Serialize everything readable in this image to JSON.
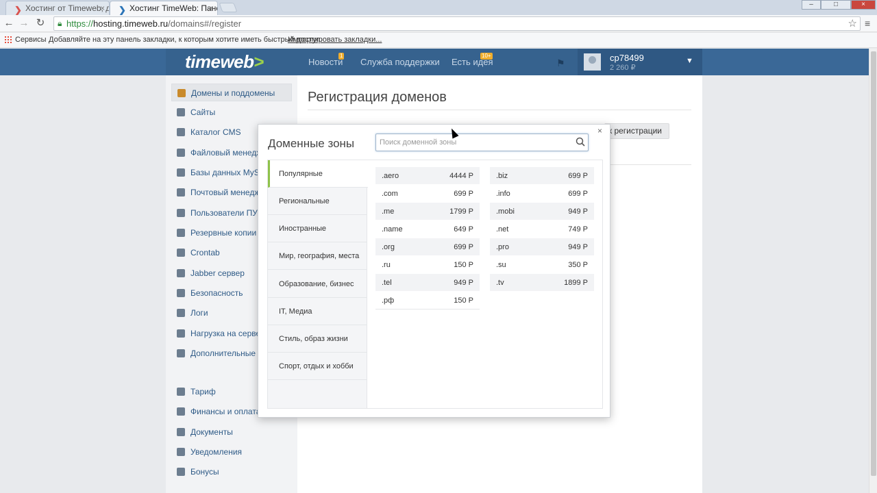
{
  "browser": {
    "tabs": [
      {
        "title": "Хостинг от Timeweb, дос"
      },
      {
        "title": "Хостинг TimeWeb: Панел"
      }
    ],
    "url_protocol": "https://",
    "url_host": "hosting.timeweb.ru",
    "url_path": "/domains#/register",
    "bookmarks": {
      "services": "Сервисы",
      "hint": "Добавляйте на эту панель закладки, к которым хотите иметь быстрый доступ.",
      "import": "Импортировать закладки..."
    }
  },
  "header": {
    "logo_text": "timeweb",
    "logo_arrow": ">",
    "nav": [
      {
        "label": "Новости",
        "badge": "1"
      },
      {
        "label": "Служба поддержки",
        "badge": ""
      },
      {
        "label": "Есть идея",
        "badge": "10+"
      }
    ],
    "user": {
      "name": "cp78499",
      "balance": "2 260 ₽"
    }
  },
  "sidebar": {
    "items": [
      {
        "label": "Домены и поддомены",
        "active": true
      },
      {
        "label": "Сайты"
      },
      {
        "label": "Каталог CMS"
      },
      {
        "label": "Файловый менеджер"
      },
      {
        "label": "Базы данных MySQL"
      },
      {
        "label": "Почтовый менеджер"
      },
      {
        "label": "Пользователи ПУ/FTP"
      },
      {
        "label": "Резервные копии"
      },
      {
        "label": "Crontab"
      },
      {
        "label": "Jabber сервер"
      },
      {
        "label": "Безопасность"
      },
      {
        "label": "Логи"
      },
      {
        "label": "Нагрузка на сервер"
      },
      {
        "label": "Дополнительные услуги"
      },
      {
        "label": "Тариф"
      },
      {
        "label": "Финансы и оплата"
      },
      {
        "label": "Документы"
      },
      {
        "label": "Уведомления"
      },
      {
        "label": "Бонусы"
      }
    ]
  },
  "main": {
    "title": "Регистрация доменов",
    "to_register_button": "к регистрации"
  },
  "modal": {
    "title": "Доменные зоны",
    "search_placeholder": "Поиск доменной зоны",
    "close": "×",
    "categories": [
      {
        "label": "Популярные",
        "active": true
      },
      {
        "label": "Региональные"
      },
      {
        "label": "Иностранные"
      },
      {
        "label": "Мир, география, места"
      },
      {
        "label": "Образование, бизнес"
      },
      {
        "label": "IT, Медиа"
      },
      {
        "label": "Стиль, образ жизни"
      },
      {
        "label": "Спорт, отдых и хобби"
      }
    ],
    "zones_left": [
      {
        "name": ".aero",
        "price": "4444 Р"
      },
      {
        "name": ".com",
        "price": "699 Р"
      },
      {
        "name": ".me",
        "price": "1799 Р"
      },
      {
        "name": ".name",
        "price": "649 Р"
      },
      {
        "name": ".org",
        "price": "699 Р"
      },
      {
        "name": ".ru",
        "price": "150 Р"
      },
      {
        "name": ".tel",
        "price": "949 Р"
      },
      {
        "name": ".рф",
        "price": "150 Р"
      }
    ],
    "zones_right": [
      {
        "name": ".biz",
        "price": "699 Р"
      },
      {
        "name": ".info",
        "price": "699 Р"
      },
      {
        "name": ".mobi",
        "price": "949 Р"
      },
      {
        "name": ".net",
        "price": "749 Р"
      },
      {
        "name": ".pro",
        "price": "949 Р"
      },
      {
        "name": ".su",
        "price": "350 Р"
      },
      {
        "name": ".tv",
        "price": "1899 Р"
      }
    ]
  },
  "colors": {
    "header_bg": "#3a6897",
    "link": "#2e5a86",
    "accent_green": "#8fc24a",
    "badge": "#f0ad2c"
  }
}
